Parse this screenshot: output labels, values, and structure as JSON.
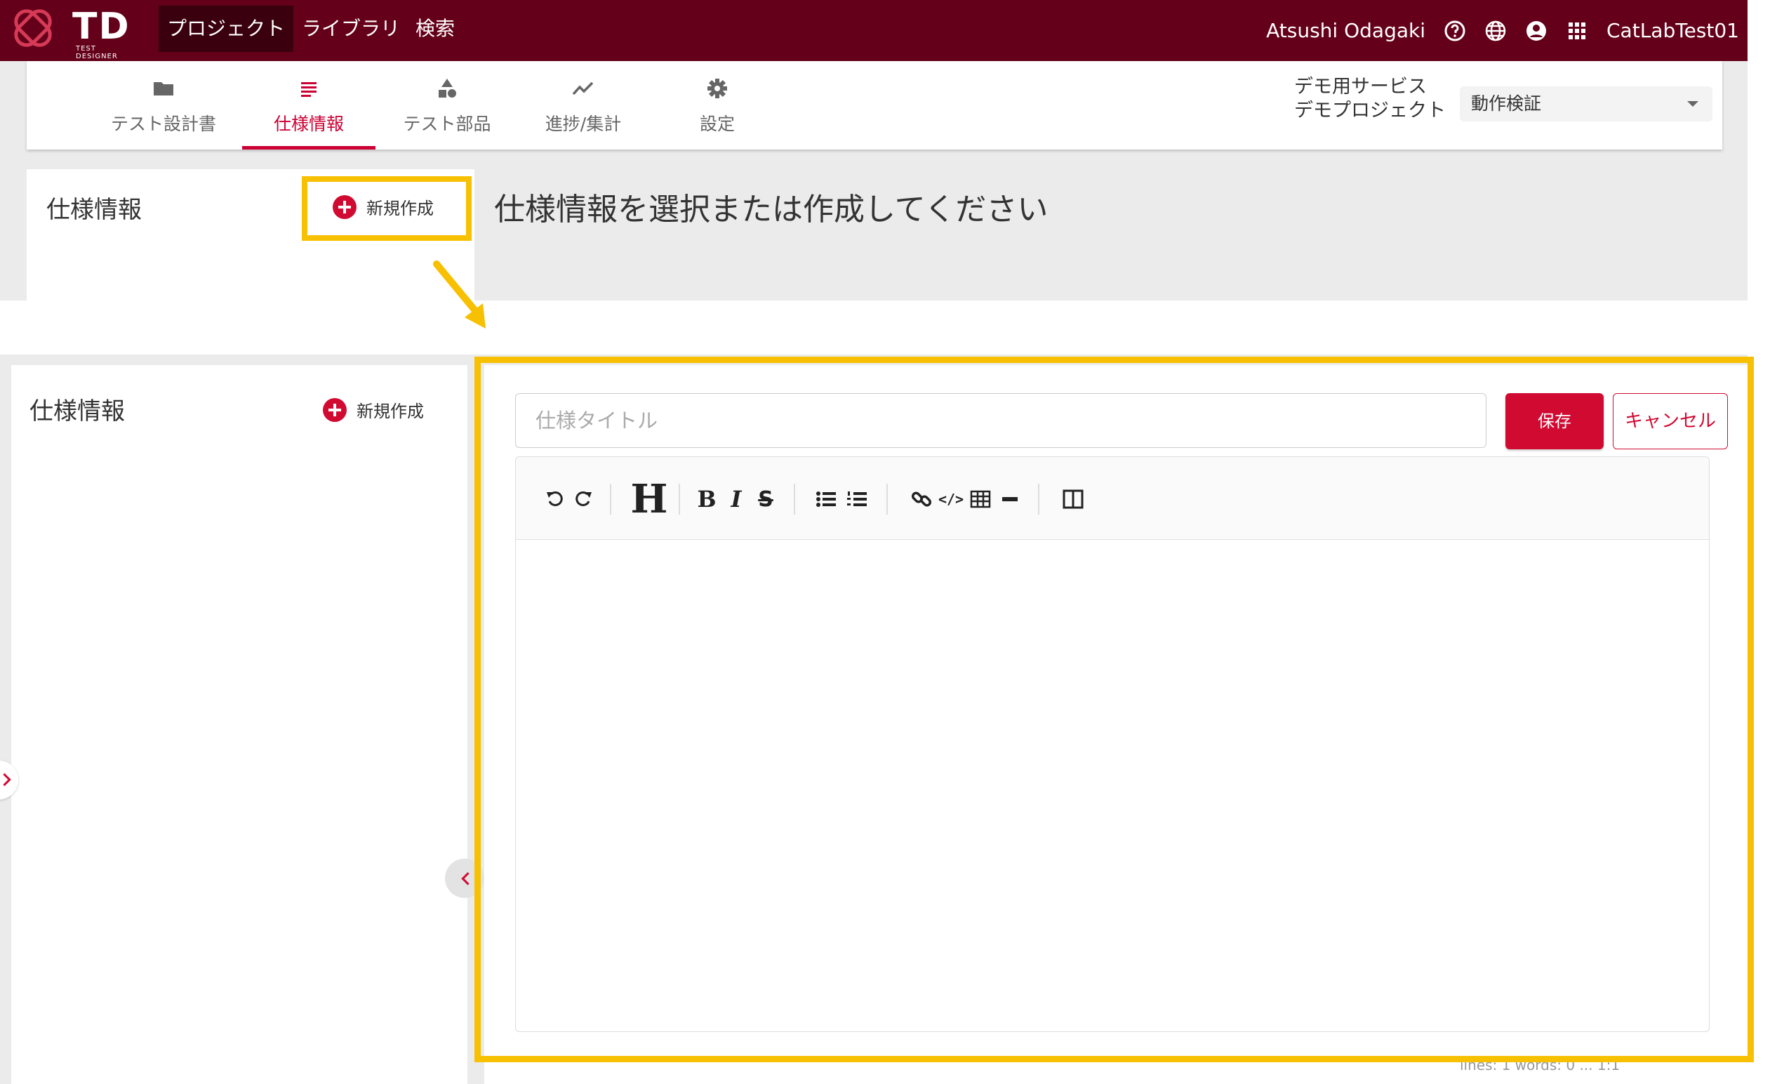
{
  "app": {
    "logo_text": "TD",
    "logo_sub": "TEST DESIGNER",
    "nav": [
      "プロジェクト",
      "ライブラリ",
      "検索"
    ],
    "user_name": "Atsushi Odagaki",
    "org_name": "CatLabTest01",
    "bar_color": "#640019"
  },
  "tabs": [
    {
      "label": "テスト設計書",
      "icon": "folder-icon"
    },
    {
      "label": "仕様情報",
      "icon": "list-icon"
    },
    {
      "label": "テスト部品",
      "icon": "shapes-icon"
    },
    {
      "label": "進捗/集計",
      "icon": "trend-icon"
    },
    {
      "label": "設定",
      "icon": "gear-icon"
    }
  ],
  "project": {
    "line1": "デモ用サービス",
    "line2": "デモプロジェクト",
    "selected": "動作検証"
  },
  "spec_panel": {
    "title": "仕様情報",
    "new_label": "新規作成",
    "prompt": "仕様情報を選択または作成してください"
  },
  "editor": {
    "title_placeholder": "仕様タイトル",
    "save_label": "保存",
    "cancel_label": "キャンセル",
    "status": "lines: 1   words: 0   ...   1:1",
    "heading_glyph": "H",
    "bold_glyph": "B",
    "italic_glyph": "I",
    "strike_glyph": "S",
    "code_glyph": "</>"
  },
  "colors": {
    "accent": "#d10a32",
    "highlight": "#f7c000"
  }
}
